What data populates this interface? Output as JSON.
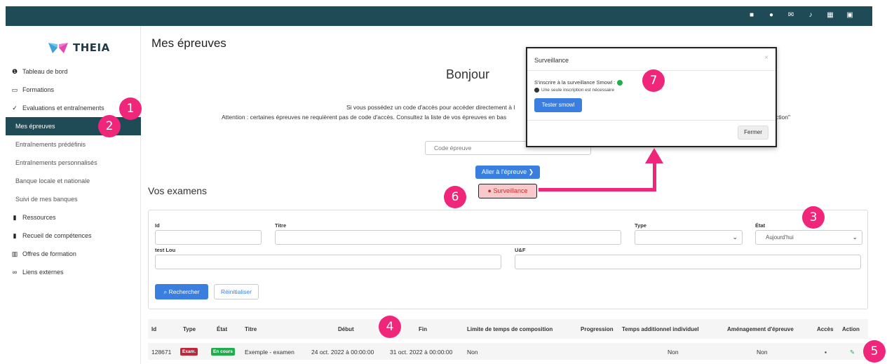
{
  "topbar": {
    "icons": [
      "windows-icon",
      "users-icon",
      "mail-icon",
      "bell-icon",
      "grid-icon",
      "id-card-icon"
    ]
  },
  "sidebar": {
    "logo_text": "THEIA",
    "items": [
      {
        "label": "Tableau de bord",
        "icon": "info-circle-icon"
      },
      {
        "label": "Formations",
        "icon": "chalkboard-icon"
      },
      {
        "label": "Evaluations et entraînements",
        "icon": "spellcheck-icon"
      },
      {
        "label": "Mes épreuves",
        "active": true
      },
      {
        "label": "Entraînements prédéfinis"
      },
      {
        "label": "Entraînements personnalisés"
      },
      {
        "label": "Banque locale et nationale"
      },
      {
        "label": "Suivi de mes banques"
      },
      {
        "label": "Ressources",
        "icon": "book-icon"
      },
      {
        "label": "Recueil de compétences",
        "icon": "clipboard-icon"
      },
      {
        "label": "Offres de formation",
        "icon": "building-icon"
      },
      {
        "label": "Liens externes",
        "icon": "link-icon"
      }
    ]
  },
  "main": {
    "title": "Mes épreuves",
    "greeting": "Bonjour",
    "info_line1": "Si vous possédez un code d'accès pour accéder directement à l",
    "info_line2": "Attention : certaines épreuves ne requièrent pas de code d'accès. Consultez la liste de vos épreuves en bas",
    "info_line2_end": "ction\"",
    "code_placeholder": "Code épreuve",
    "aller_button": "Aller à l'épreuve ❯",
    "surveillance_button": "Surveillance",
    "vos_examens": "Vos examens"
  },
  "filters": {
    "id_label": "Id",
    "titre_label": "Titre",
    "type_label": "Type",
    "etat_label": "État",
    "etat_value": "Aujourd'hui",
    "test_label": "test Lou",
    "uf_label": "U&F",
    "search_button": "Rechercher",
    "reset_button": "Réinitialiser"
  },
  "table": {
    "headers": [
      "Id",
      "Type",
      "État",
      "Titre",
      "Début",
      "Fin",
      "Limite de temps de composition",
      "Progression",
      "Temps additionnel individuel",
      "Aménagement d'épreuve",
      "Accès",
      "Action"
    ],
    "rows": [
      {
        "id": "128671",
        "type": "Exam.",
        "etat": "En cours",
        "titre": "Exemple - examen",
        "debut": "24 oct. 2022 à 00:00:00",
        "fin": "31 oct. 2022 à 00:00:00",
        "limite": "Non",
        "temps_add": "Non",
        "amenagement": "Non"
      }
    ]
  },
  "modal": {
    "title": "Surveillance",
    "close": "×",
    "line1": "S'inscrire à la surveillance Smowl :",
    "line2": "Une seule inscription est nécessaire",
    "test_button": "Tester smowl",
    "close_button": "Fermer"
  },
  "markers": [
    "1",
    "2",
    "3",
    "4",
    "5",
    "6",
    "7"
  ],
  "colors": {
    "topbar": "#1f4b56",
    "primary": "#3a7ee0",
    "marker": "#f0267a",
    "exam_badge": "#c0273b",
    "status_badge": "#1fae4b"
  }
}
